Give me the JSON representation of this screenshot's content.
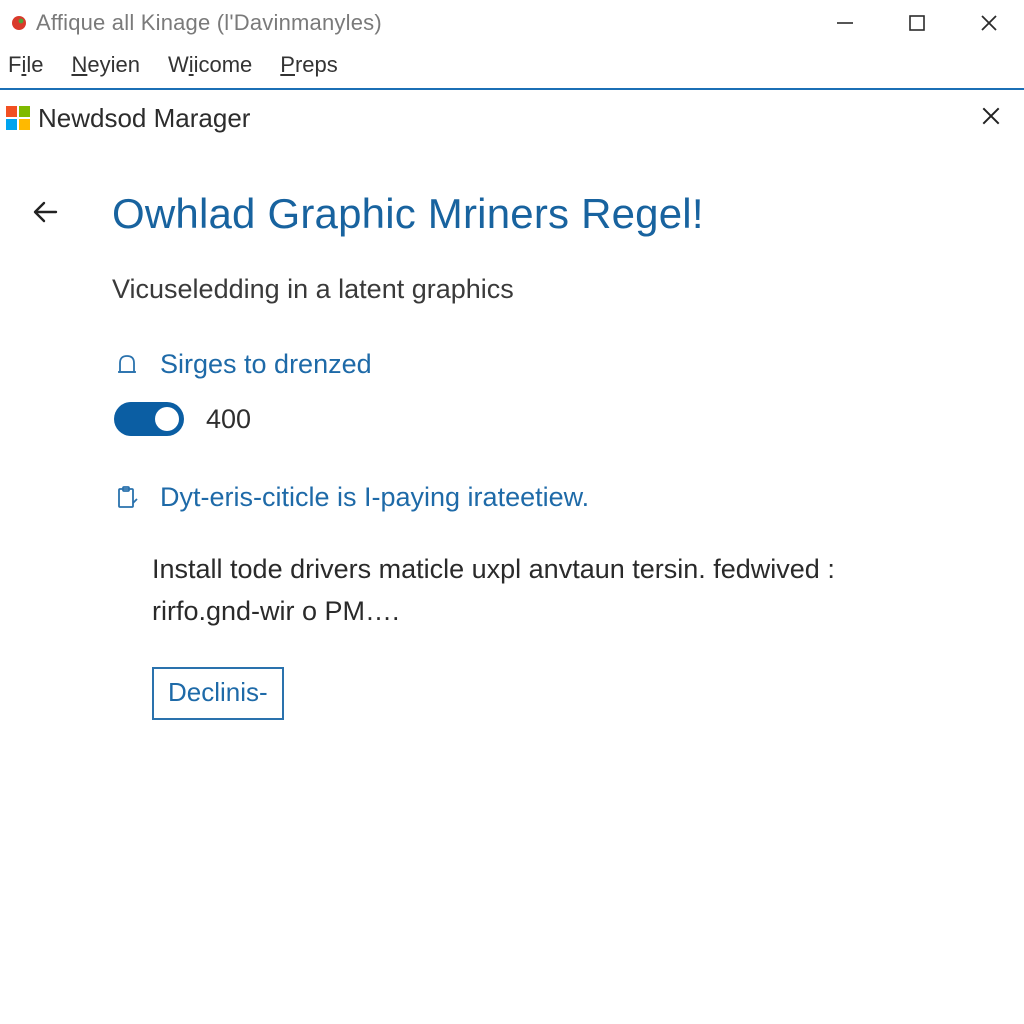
{
  "window": {
    "title": "Affique all Kinage (l'Davinmanyles)"
  },
  "menu": {
    "items": [
      {
        "pre": "F",
        "ul": "i",
        "post": "le"
      },
      {
        "pre": "",
        "ul": "N",
        "post": "eyien"
      },
      {
        "pre": "W",
        "ul": "i",
        "post": "icome"
      },
      {
        "pre": "",
        "ul": "P",
        "post": "reps"
      }
    ]
  },
  "panel": {
    "title": "Newdsod Marager"
  },
  "page": {
    "heading": "Owhlad Graphic Mriners Regel!",
    "subtitle": "Vicuseledding in a latent graphics"
  },
  "setting": {
    "label": "Sirges to drenzed",
    "toggle_on": true,
    "toggle_value": "400"
  },
  "status": {
    "text": "Dyt-eris-citicle is I-paying irateetiew."
  },
  "body": {
    "text": "Install tode drivers maticle uxpl anvtaun tersin. fedwived : rirfo.gnd-wir o PM…."
  },
  "actions": {
    "decline_label": "Declinis-"
  }
}
